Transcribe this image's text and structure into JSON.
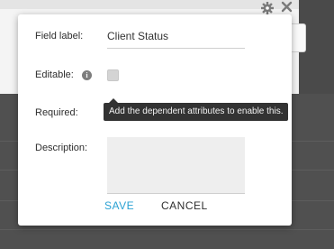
{
  "popover": {
    "field_label": {
      "label": "Field label:",
      "value": "Client Status"
    },
    "editable": {
      "label": "Editable:",
      "checked": false
    },
    "required": {
      "label": "Required:",
      "checked": false
    },
    "description": {
      "label": "Description:",
      "value": ""
    },
    "info_icon": "info-icon",
    "tooltip": "Add the dependent attributes to enable this.",
    "save_label": "SAVE",
    "cancel_label": "CANCEL"
  },
  "top_icons": [
    "gear-icon",
    "close-icon"
  ],
  "colors": {
    "save": "#2aa1d3",
    "tooltip_bg": "#333333",
    "checkbox": "#d4d4d4",
    "overlay": "#4a4a4a"
  }
}
